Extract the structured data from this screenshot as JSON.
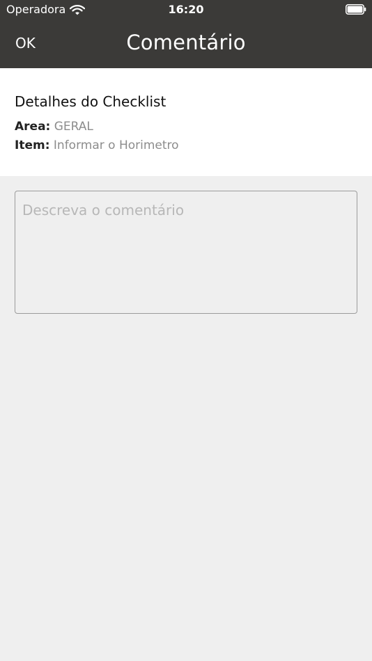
{
  "status_bar": {
    "carrier": "Operadora",
    "time": "16:20",
    "wifi_icon": "wifi-icon",
    "battery_icon": "battery-full-icon"
  },
  "nav": {
    "ok_label": "OK",
    "title": "Comentário"
  },
  "details": {
    "title": "Detalhes do Checklist",
    "area_label": "Area:",
    "area_value": "GERAL",
    "item_label": "Item:",
    "item_value": "Informar o Horimetro"
  },
  "comment": {
    "value": "",
    "placeholder": "Descreva o comentário"
  },
  "colors": {
    "header_bg": "#3b3a38",
    "page_bg": "#efefef",
    "card_bg": "#ffffff",
    "muted_text": "#8c8c8c",
    "border": "#9b9b9b"
  }
}
